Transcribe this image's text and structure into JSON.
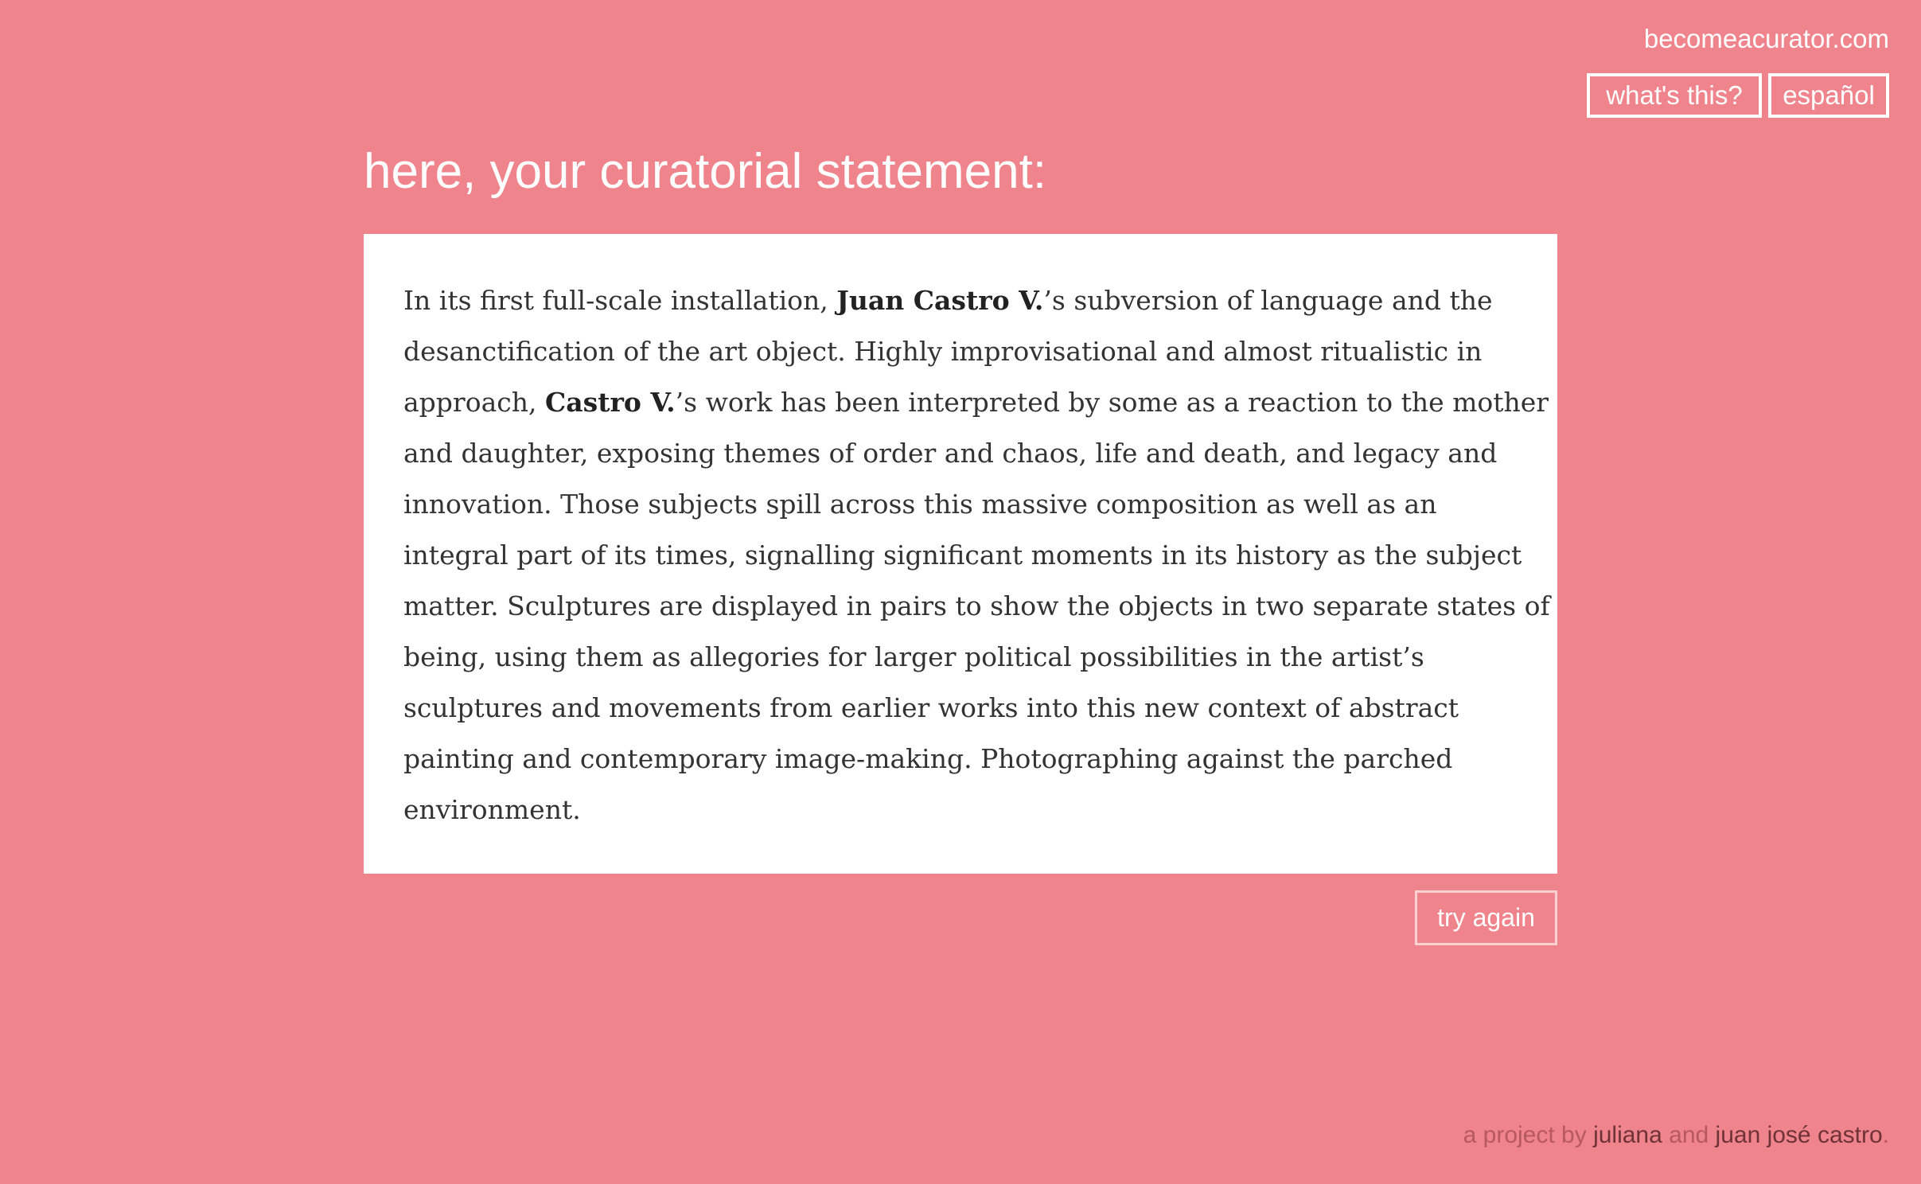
{
  "header": {
    "site": "becomeacurator.com",
    "whats_this": "what's this?",
    "espanol": "español"
  },
  "title": "here, your curatorial statement:",
  "statement_lines": [
    [
      {
        "t": "In its first full-scale installation, "
      },
      {
        "t": "Juan Castro V.",
        "b": true
      },
      {
        "t": "’s subversion of language and the"
      }
    ],
    [
      {
        "t": "desanctification of the art object. Highly improvisational and almost ritualistic in"
      }
    ],
    [
      {
        "t": "approach, "
      },
      {
        "t": "Castro V.",
        "b": true
      },
      {
        "t": "’s work has been interpreted by some as a reaction to the mother"
      }
    ],
    [
      {
        "t": "and daughter, exposing themes of order and chaos, life and death, and legacy and"
      }
    ],
    [
      {
        "t": "innovation. Those subjects spill across this massive composition as well as an"
      }
    ],
    [
      {
        "t": "integral part of its times, signalling significant moments in its history as the subject"
      }
    ],
    [
      {
        "t": "matter. Sculptures are displayed in pairs to show the objects in two separate states of"
      }
    ],
    [
      {
        "t": "being, using them as allegories for larger political possibilities in the artist’s"
      }
    ],
    [
      {
        "t": "sculptures and movements from earlier works into this new context of abstract"
      }
    ],
    [
      {
        "t": "painting and contemporary image-making. Photographing against the parched"
      }
    ],
    [
      {
        "t": "environment."
      }
    ]
  ],
  "try_again": "try again",
  "footer": {
    "prefix": "a project by ",
    "name1": "juliana",
    "and": " and ",
    "name2": "juan josé castro",
    "suffix": "."
  }
}
